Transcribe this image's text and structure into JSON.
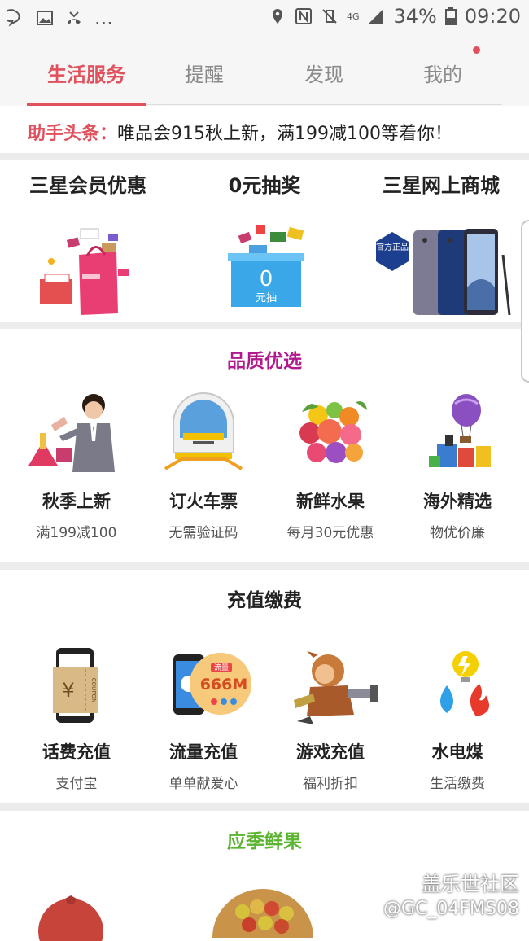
{
  "status_bar": {
    "battery": "34%",
    "time": "09:20",
    "ellipsis": "...",
    "network": "4G"
  },
  "tabs": [
    {
      "label": "生活服务",
      "active": true
    },
    {
      "label": "提醒",
      "active": false
    },
    {
      "label": "发现",
      "active": false
    },
    {
      "label": "我的",
      "active": false
    }
  ],
  "news": {
    "label": "助手头条：",
    "text": "唯品会915秋上新，满199减100等着你！"
  },
  "promos": [
    {
      "title": "三星会员优惠",
      "icon": "shopping-bag-gifts"
    },
    {
      "title": "0元抽奖",
      "icon": "lottery-box",
      "box_text_1": "0",
      "box_text_2": "元抽"
    },
    {
      "title": "三星网上商城",
      "icon": "galaxy-note-phones",
      "badge": "官方正品"
    }
  ],
  "quality": {
    "title": "品质优选",
    "title_color": "#b01a8c",
    "items": [
      {
        "title": "秋季上新",
        "sub": "满199减100",
        "icon": "celebrity-fashion"
      },
      {
        "title": "订火车票",
        "sub": "无需验证码",
        "icon": "train"
      },
      {
        "title": "新鲜水果",
        "sub": "每月30元优惠",
        "icon": "fruits"
      },
      {
        "title": "海外精选",
        "sub": "物优价廉",
        "icon": "balloon-goods"
      }
    ]
  },
  "recharge": {
    "title": "充值缴费",
    "items": [
      {
        "title": "话费充值",
        "sub": "支付宝",
        "icon": "phone-coupon",
        "coupon_symbol": "¥",
        "coupon_text": "COUPON"
      },
      {
        "title": "流量充值",
        "sub": "单单献爱心",
        "icon": "data-traffic",
        "badge_top": "流量",
        "badge_value": "666M"
      },
      {
        "title": "游戏充值",
        "sub": "福利折扣",
        "icon": "game-character"
      },
      {
        "title": "水电煤",
        "sub": "生活缴费",
        "icon": "utilities"
      }
    ]
  },
  "seasonal": {
    "title": "应季鲜果",
    "title_color": "#5cb531"
  },
  "watermark": {
    "line1": "盖乐世社区",
    "line2": "@GC_04FMS08"
  },
  "colors": {
    "accent": "#e0505d",
    "tab_inactive": "#8a8a8a"
  }
}
